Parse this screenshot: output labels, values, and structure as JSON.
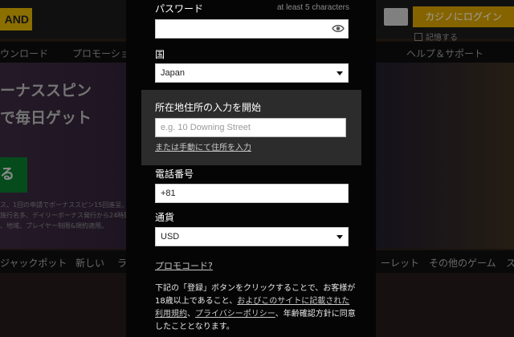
{
  "background": {
    "logo_text": "AND",
    "nav": [
      "ウンロード",
      "プロモーショ",
      "ヘルプ＆サポート"
    ],
    "hero_lines": [
      "ーナススピン",
      "で毎日ゲット"
    ],
    "cta": "る",
    "fine_print": [
      "ス、1回の申請でボーナススピン15回進呈、最",
      "施行名多、デイリーボーナス発行から24時間有",
      "、地域、プレイヤー制限&規約適用。"
    ],
    "games_nav": [
      "ジャックポット",
      "新しい",
      "ラ",
      "ーレット",
      "その他のゲーム",
      "ス"
    ],
    "login_button": "カジノにログイン",
    "remember_me": "記憶する"
  },
  "form": {
    "password": {
      "label": "パスワード",
      "hint": "at least 5 characters",
      "value": ""
    },
    "country": {
      "label": "国",
      "value": "Japan"
    },
    "address": {
      "label": "所在地住所の入力を開始",
      "placeholder": "e.g. 10 Downing Street",
      "manual_link": "または手動にて住所を入力"
    },
    "phone": {
      "label": "電話番号",
      "value": "+81"
    },
    "currency": {
      "label": "通貨",
      "value": "USD"
    },
    "promo_link": "プロモコード?",
    "legal": {
      "part1": "下記の「登録」ボタンをクリックすることで、お客様が18歳以上であること、",
      "link1": "およびこのサイトに記載された利用規約",
      "sep": "、",
      "link2": "プライバシーポリシー",
      "part2": "、年齢確認方針に同意したこととなります。"
    }
  }
}
